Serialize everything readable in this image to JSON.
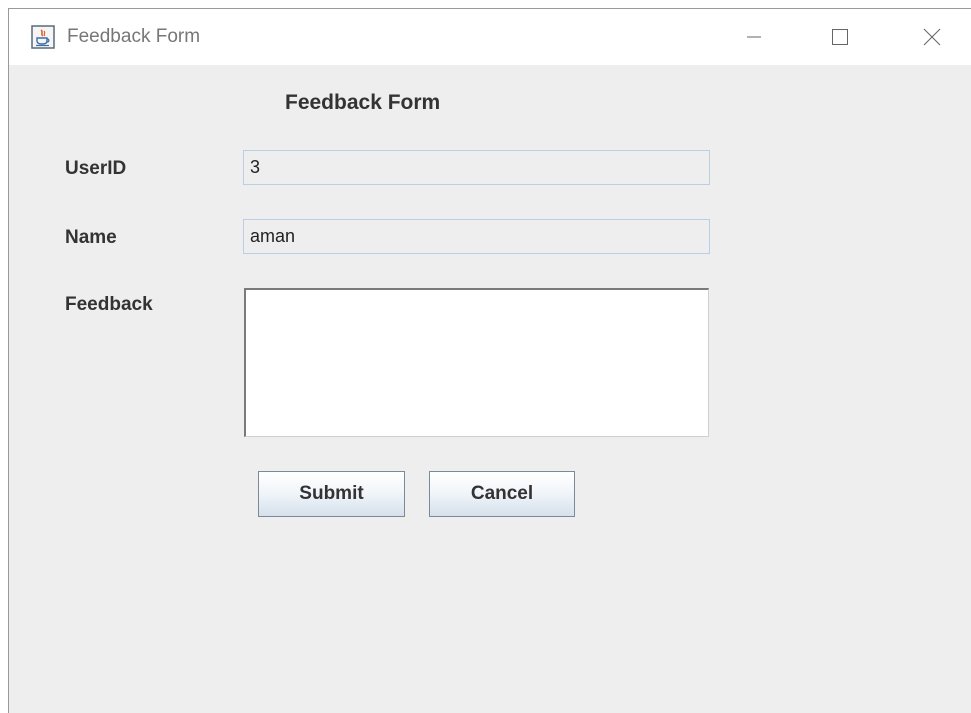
{
  "window": {
    "title": "Feedback Form",
    "controls": {
      "minimize_icon": "minimize-icon",
      "maximize_icon": "maximize-icon",
      "close_icon": "close-icon"
    },
    "app_icon": "java-icon"
  },
  "form": {
    "heading": "Feedback Form",
    "fields": {
      "userid": {
        "label": "UserID",
        "value": "3"
      },
      "name": {
        "label": "Name",
        "value": "aman"
      },
      "feedback": {
        "label": "Feedback",
        "value": ""
      }
    },
    "buttons": {
      "submit": "Submit",
      "cancel": "Cancel"
    }
  },
  "colors": {
    "window_background": "#eeeeee",
    "titlebar_background": "#ffffff",
    "field_border": "#b8cfe5",
    "text": "#333333"
  }
}
